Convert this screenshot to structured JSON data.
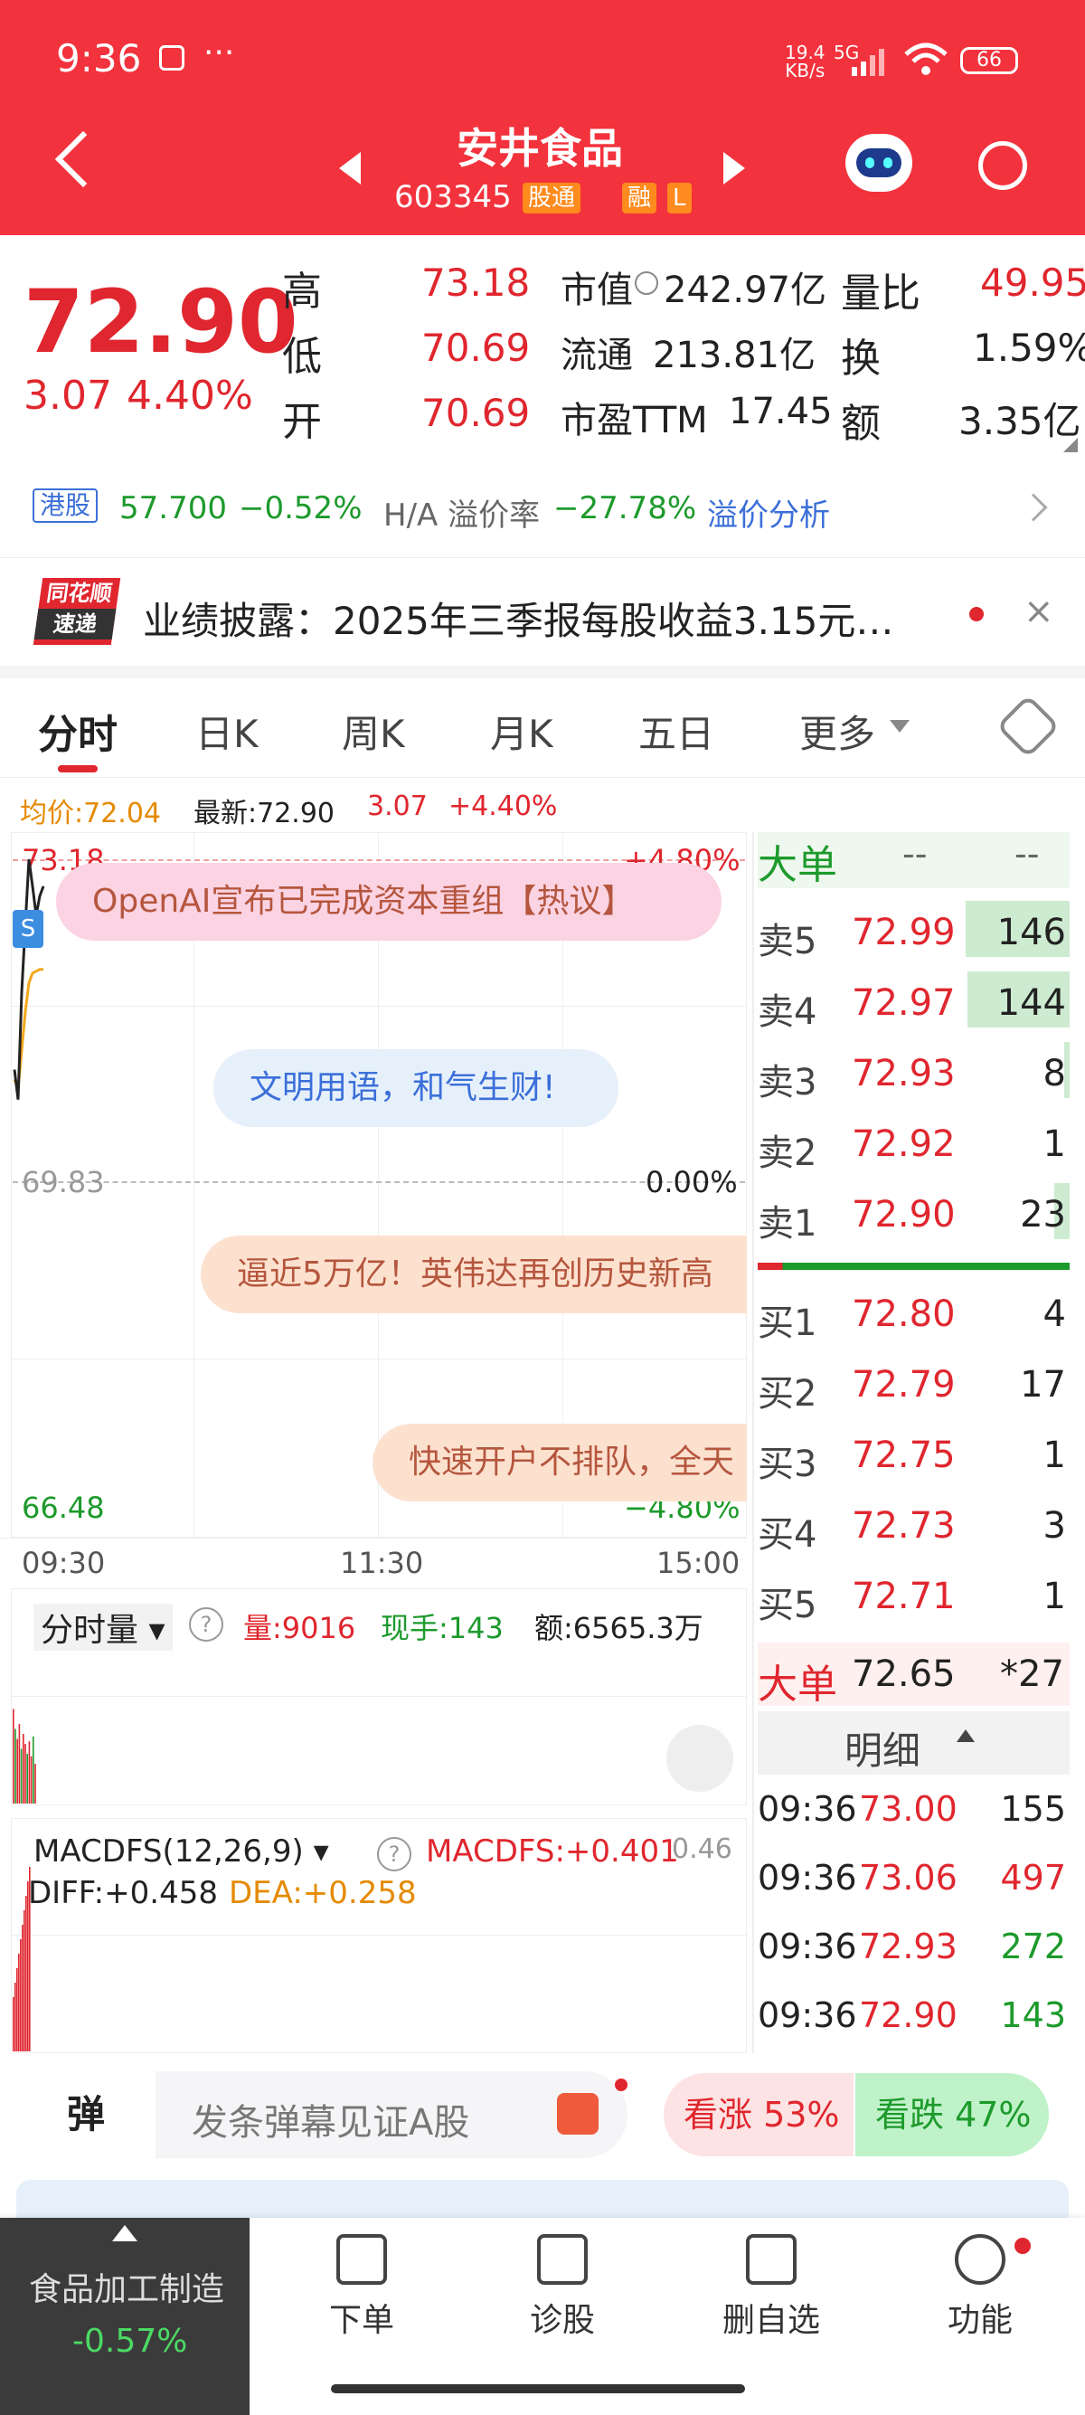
{
  "status": {
    "time": "9:36",
    "speed": "19.4\nKB/s",
    "network": "5G",
    "battery": "66"
  },
  "header": {
    "title": "安井食品",
    "code": "603345",
    "tag_hk": "股通",
    "tag_rong": "融",
    "tag_l": "L"
  },
  "quote": {
    "price": "72.90",
    "change": "3.07",
    "pct": "4.40%",
    "high_label": "高",
    "high": "73.18",
    "low_label": "低",
    "low": "70.69",
    "open_label": "开",
    "open": "70.69",
    "mcap_label": "市值",
    "mcap": "242.97亿",
    "float_label": "流通",
    "float": "213.81亿",
    "pe_label": "市盈TTM",
    "pe": "17.45",
    "vr_label": "量比",
    "vr": "49.95",
    "turn_label": "换",
    "turn": "1.59%",
    "amt_label": "额",
    "amt": "3.35亿"
  },
  "hk": {
    "tag": "港股",
    "price": "57.700",
    "pct": "−0.52%",
    "premium_label": "H/A 溢价率",
    "premium": "−27.78%",
    "analysis": "溢价分析"
  },
  "news": {
    "logo1": "同花顺",
    "logo2": "速递",
    "text": "业绩披露：2025年三季报每股收益3.15元…"
  },
  "tabs": [
    "分时",
    "日K",
    "周K",
    "月K",
    "五日",
    "更多"
  ],
  "chart_info": {
    "avg": "均价:72.04",
    "latest": "最新:72.90",
    "chg": "3.07",
    "pct": "+4.40%"
  },
  "chart_data": {
    "type": "line",
    "title": "",
    "y_top": "73.18",
    "y_mid": "69.83",
    "y_bot": "66.48",
    "pct_top": "+4.80%",
    "pct_mid": "0.00%",
    "pct_bot": "−4.80%",
    "x_ticks": [
      "09:30",
      "11:30",
      "15:00"
    ],
    "ylim": [
      66.48,
      73.18
    ],
    "price": [
      71.0,
      70.69,
      71.8,
      72.5,
      73.18,
      72.9,
      72.6,
      72.8,
      72.9
    ],
    "avg": [
      70.9,
      70.8,
      71.2,
      71.6,
      71.9,
      72.0,
      72.02,
      72.04,
      72.04
    ],
    "series": [
      {
        "name": "均价",
        "values": [
          70.9,
          70.8,
          71.2,
          71.6,
          71.9,
          72.0,
          72.02,
          72.04,
          72.04
        ]
      }
    ]
  },
  "bubbles": [
    "OpenAI宣布已完成资本重组【热议】",
    "文明用语，和气生财!",
    "逼近5万亿！英伟达再创历史新高",
    "快速开户不排队，全天"
  ],
  "orderbook": {
    "title": "大单",
    "dash1": "--",
    "dash2": "--",
    "sells": [
      {
        "l": "卖5",
        "p": "72.99",
        "v": "146",
        "bar": 1.0
      },
      {
        "l": "卖4",
        "p": "72.97",
        "v": "144",
        "bar": 0.98
      },
      {
        "l": "卖3",
        "p": "72.93",
        "v": "8",
        "bar": 0.05
      },
      {
        "l": "卖2",
        "p": "72.92",
        "v": "1",
        "bar": 0.0
      },
      {
        "l": "卖1",
        "p": "72.90",
        "v": "23",
        "bar": 0.15
      }
    ],
    "buys": [
      {
        "l": "买1",
        "p": "72.80",
        "v": "4"
      },
      {
        "l": "买2",
        "p": "72.79",
        "v": "17"
      },
      {
        "l": "买3",
        "p": "72.75",
        "v": "1"
      },
      {
        "l": "买4",
        "p": "72.73",
        "v": "3"
      },
      {
        "l": "买5",
        "p": "72.71",
        "v": "1"
      }
    ],
    "big_label": "大单",
    "big_price": "72.65",
    "big_vol": "*27",
    "detail": "明细",
    "ticks": [
      {
        "t": "09:36",
        "p": "73.00",
        "v": "155"
      },
      {
        "t": "09:36",
        "p": "73.06",
        "v": "497"
      },
      {
        "t": "09:36",
        "p": "72.93",
        "v": "272"
      },
      {
        "t": "09:36",
        "p": "72.90",
        "v": "143"
      }
    ]
  },
  "volume": {
    "label": "分时量",
    "vol": "量:9016",
    "hand": "现手:143",
    "amt": "额:6565.3万"
  },
  "macd": {
    "label": "MACDFS(12,26,9)",
    "macd": "MACDFS:+0.401",
    "diff": "DIFF:+0.458",
    "dea": "DEA:+0.258",
    "right": "0.46"
  },
  "danmu": {
    "icon": "弹",
    "placeholder": "发条弹幕见证A股",
    "up": "看涨 53%",
    "down": "看跌 47%"
  },
  "bottom": {
    "sector": "食品加工制造",
    "sector_pct": "-0.57%",
    "btns": [
      "下单",
      "诊股",
      "删自选",
      "功能"
    ]
  }
}
